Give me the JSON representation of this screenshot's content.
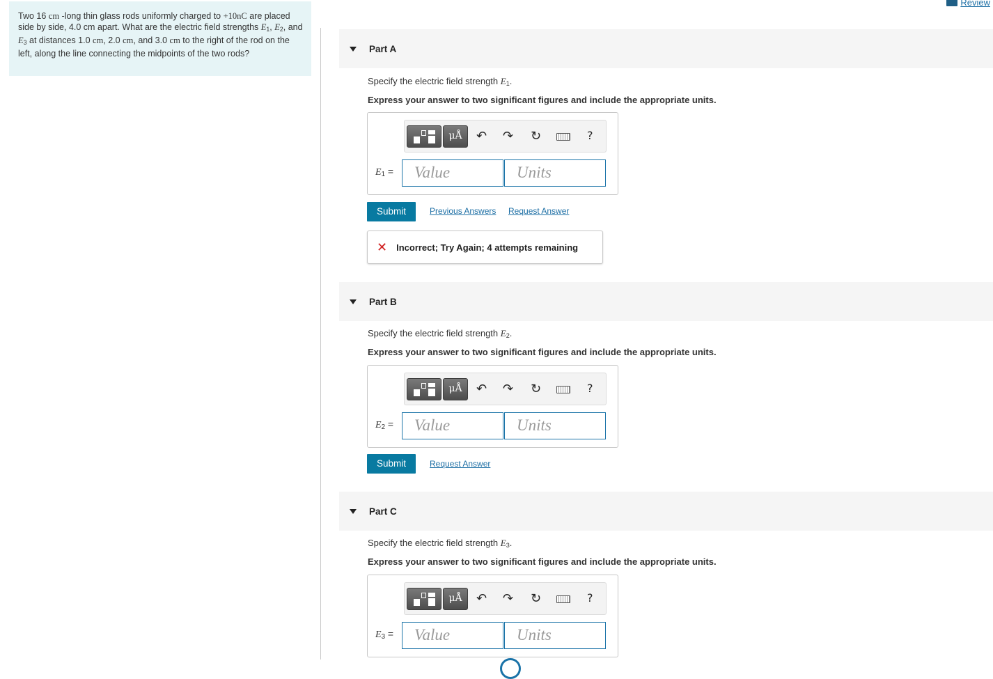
{
  "review": {
    "label": "Review"
  },
  "problem": {
    "p1": "Two 16 ",
    "cm1": "cm",
    "p2": " -long thin glass rods uniformly charged to ",
    "charge": "+10nC",
    "p3": " are placed side by side, 4.0 cm apart. What are the electric field strengths ",
    "e1": "E",
    "p4": ", ",
    "e2": "E",
    "p5": ", and ",
    "e3": "E",
    "p6": " at distances 1.0 ",
    "cm2": "cm",
    "p7": ", 2.0 ",
    "cm3": "cm",
    "p8": ", and 3.0 ",
    "cm4": "cm",
    "p9": " to the right of the rod on the left, along the line connecting the midpoints of the two rods?"
  },
  "parts": [
    {
      "title": "Part A",
      "spec_text": "Specify the electric field strength ",
      "var": "E",
      "sub": "1",
      "express": "Express your answer to two significant figures and include the appropriate units.",
      "value_placeholder": "Value",
      "units_placeholder": "Units",
      "submit": "Submit",
      "previous_answers": "Previous Answers",
      "request_answer": "Request Answer",
      "feedback": "Incorrect; Try Again; 4 attempts remaining"
    },
    {
      "title": "Part B",
      "spec_text": "Specify the electric field strength ",
      "var": "E",
      "sub": "2",
      "express": "Express your answer to two significant figures and include the appropriate units.",
      "value_placeholder": "Value",
      "units_placeholder": "Units",
      "submit": "Submit",
      "request_answer": "Request Answer"
    },
    {
      "title": "Part C",
      "spec_text": "Specify the electric field strength ",
      "var": "E",
      "sub": "3",
      "express": "Express your answer to two significant figures and include the appropriate units.",
      "value_placeholder": "Value",
      "units_placeholder": "Units"
    }
  ],
  "toolbar": {
    "mu_label": "μÅ",
    "undo": "↶",
    "redo": "↷",
    "reset": "↻",
    "help": "?"
  },
  "colors": {
    "accent": "#087aa1",
    "problem_bg": "#e6f4f6",
    "error": "#d01f1f"
  }
}
